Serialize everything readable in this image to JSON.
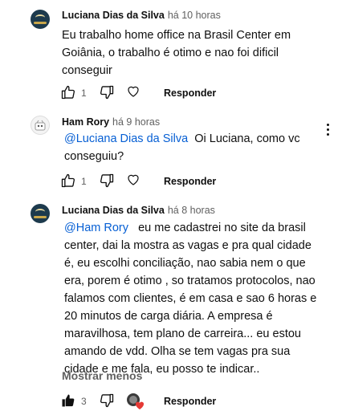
{
  "comments": [
    {
      "author": "Luciana Dias da Silva",
      "time": "há 10 horas",
      "text": "Eu trabalho home office na Brasil Center em Goiânia, o trabalho é otimo e nao foi dificil conseguir",
      "likes": "1",
      "reply_label": "Responder"
    },
    {
      "author": "Ham Rory",
      "time": "há 9 horas",
      "mention": "@Luciana Dias da Silva",
      "text": "Oi Luciana, como vc conseguiu?",
      "likes": "1",
      "reply_label": "Responder"
    },
    {
      "author": "Luciana Dias da Silva",
      "time": "há 8 horas",
      "mention": "@Ham Rory",
      "text": "eu me cadastrei no site da brasil center, dai la mostra as vagas e pra qual cidade é, eu escolhi conciliação, nao sabia nem o  que era, porem  é otimo , so tratamos protocolos, nao falamos com clientes, é em casa e sao 6 horas  e 20 minutos de carga diária. A empresa é maravilhosa, tem plano de  carreira... eu estou amando de vdd. Olha se tem vagas pra sua cidade e   me fala, eu posso te indicar..",
      "show_less": "Mostrar menos",
      "likes": "3",
      "reply_label": "Responder"
    }
  ],
  "colors": {
    "mention": "#065fd4",
    "heart": "#e53935",
    "secondary_text": "#606060"
  },
  "icons": [
    "thumbs-up-icon",
    "thumbs-down-icon",
    "heart-icon",
    "more-vert-icon",
    "thumbs-up-filled-icon",
    "creator-heart-icon"
  ]
}
